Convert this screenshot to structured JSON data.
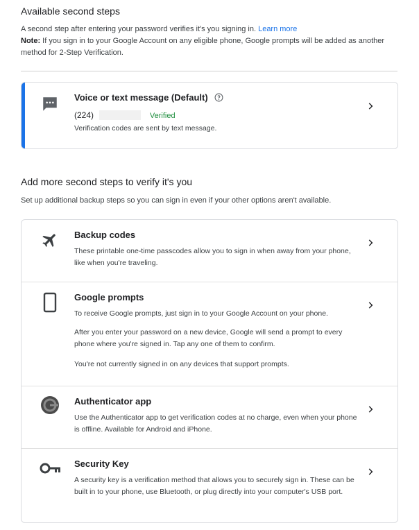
{
  "header": {
    "title": "Available second steps",
    "desc_line": "A second step after entering your password verifies it's you signing in.",
    "learn_more": "Learn more",
    "note_label": "Note:",
    "note_text": "If you sign in to your Google Account on any eligible phone, Google prompts will be added as another method for 2-Step Verification."
  },
  "default_method": {
    "title": "Voice or text message (Default)",
    "phone": "(224)",
    "status": "Verified",
    "description": "Verification codes are sent by text message.",
    "icon": "message-icon",
    "status_color": "#1e8e3e",
    "accent_color": "#1a73e8"
  },
  "more": {
    "title": "Add more second steps to verify it's you",
    "description": "Set up additional backup steps so you can sign in even if your other options aren't available.",
    "items": [
      {
        "title": "Backup codes",
        "icon": "airplane-icon",
        "lines": [
          "These printable one-time passcodes allow you to sign in when away from your phone, like when you're traveling."
        ]
      },
      {
        "title": "Google prompts",
        "icon": "phone-icon",
        "lines": [
          "To receive Google prompts, just sign in to your Google Account on your phone.",
          "After you enter your password on a new device, Google will send a prompt to every phone where you're signed in. Tap any one of them to confirm.",
          "You're not currently signed in on any devices that support prompts."
        ]
      },
      {
        "title": "Authenticator app",
        "icon": "authenticator-icon",
        "lines": [
          "Use the Authenticator app to get verification codes at no charge, even when your phone is offline. Available for Android and iPhone."
        ]
      },
      {
        "title": "Security Key",
        "icon": "key-icon",
        "lines": [
          "A security key is a verification method that allows you to securely sign in. These can be built in to your phone, use Bluetooth, or plug directly into your computer's USB port."
        ]
      }
    ]
  }
}
